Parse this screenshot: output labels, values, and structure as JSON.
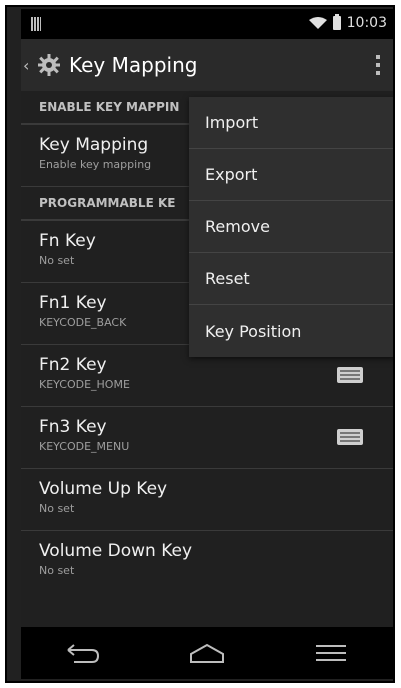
{
  "status_bar": {
    "time": "10:03"
  },
  "action_bar": {
    "title": "Key Mapping"
  },
  "sections": [
    {
      "title": "ENABLE KEY MAPPIN"
    },
    {
      "title": "PROGRAMMABLE KE"
    }
  ],
  "items": [
    {
      "title": "Key Mapping",
      "subtitle": "Enable key mapping"
    },
    {
      "title": "Fn Key",
      "subtitle": "No set"
    },
    {
      "title": "Fn1 Key",
      "subtitle": "KEYCODE_BACK"
    },
    {
      "title": "Fn2 Key",
      "subtitle": "KEYCODE_HOME",
      "icon": "keyboard-icon"
    },
    {
      "title": "Fn3 Key",
      "subtitle": "KEYCODE_MENU",
      "icon": "keyboard-icon"
    },
    {
      "title": "Volume Up Key",
      "subtitle": "No set"
    },
    {
      "title": "Volume Down Key",
      "subtitle": "No set"
    }
  ],
  "overflow_menu": {
    "items": [
      "Import",
      "Export",
      "Remove",
      "Reset",
      "Key Position"
    ]
  }
}
